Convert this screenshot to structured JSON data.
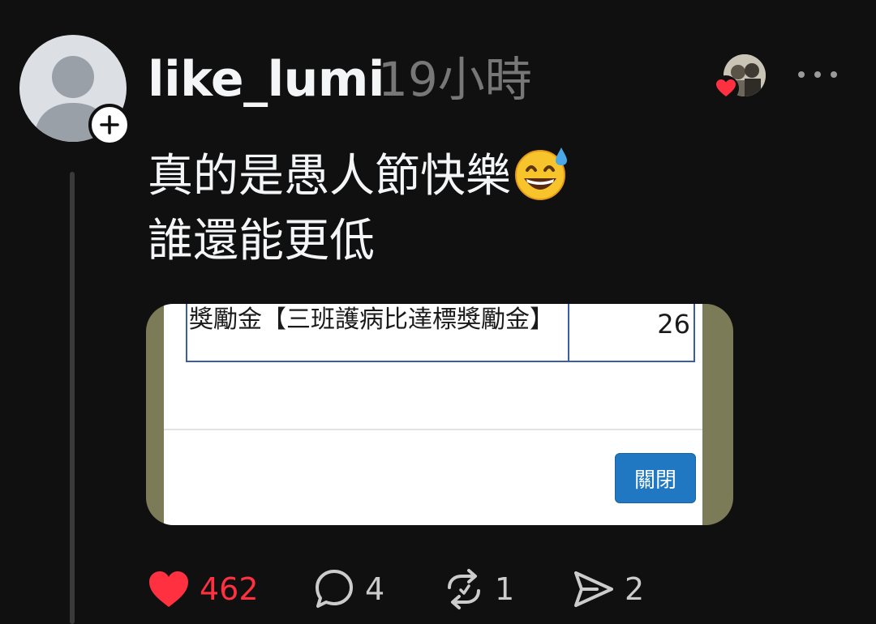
{
  "post": {
    "username": "like_lumi",
    "timestamp": "19小時",
    "text_line_1": "真的是愚人節快樂",
    "text_line_2": "誰還能更低"
  },
  "media": {
    "table_label": "獎勵金【三班護病比達標獎勵金】",
    "table_value": "26",
    "close_button": "關閉"
  },
  "actions": {
    "likes": "462",
    "comments": "4",
    "reposts": "1",
    "shares": "2"
  },
  "icons": {
    "follow": "plus-icon",
    "liked_by": "heart-icon",
    "more": "more-icon",
    "like": "heart-icon",
    "comment": "comment-icon",
    "repost": "repost-icon",
    "share": "share-icon",
    "emoji": "grinning-face-with-sweat"
  },
  "colors": {
    "background": "#101010",
    "like_red": "#ff3040",
    "button_blue": "#1f78c1"
  }
}
